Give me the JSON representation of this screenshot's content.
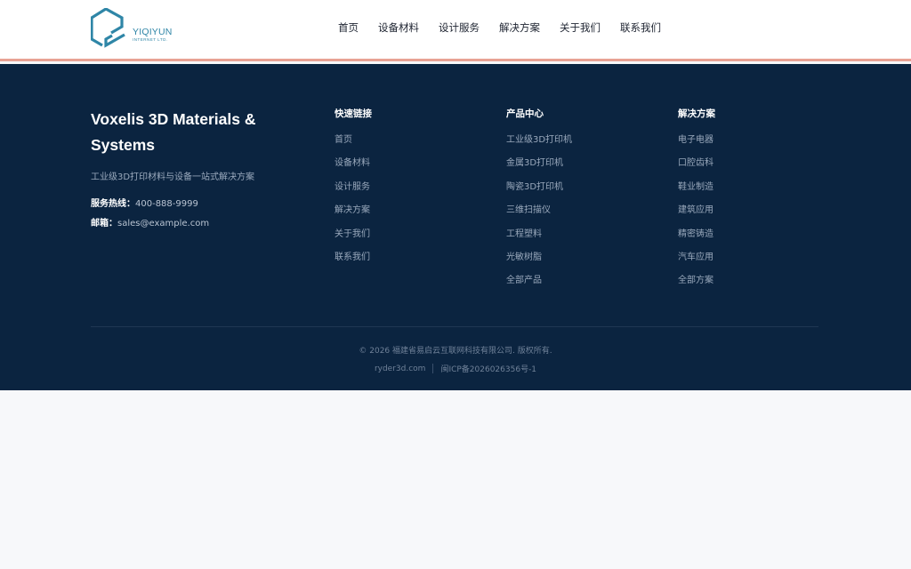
{
  "header": {
    "logo": {
      "name": "YIQIYUN",
      "subtitle": "INTERNET LTD.",
      "color": "#2f86a7"
    },
    "nav": [
      {
        "label": "首页"
      },
      {
        "label": "设备材料"
      },
      {
        "label": "设计服务"
      },
      {
        "label": "解决方案"
      },
      {
        "label": "关于我们"
      },
      {
        "label": "联系我们"
      }
    ]
  },
  "footer": {
    "brand": {
      "title": "Voxelis 3D Materials & Systems",
      "description": "工业级3D打印材料与设备一站式解决方案",
      "hotline_label": "服务热线：",
      "hotline_value": "400-888-9999",
      "email_label": "邮箱：",
      "email_value": "sales@example.com"
    },
    "columns": [
      {
        "title": "快速链接",
        "links": [
          "首页",
          "设备材料",
          "设计服务",
          "解决方案",
          "关于我们",
          "联系我们"
        ]
      },
      {
        "title": "产品中心",
        "links": [
          "工业级3D打印机",
          "金属3D打印机",
          "陶瓷3D打印机",
          "三维扫描仪",
          "工程塑料",
          "光敏树脂",
          "全部产品"
        ]
      },
      {
        "title": "解决方案",
        "links": [
          "电子电器",
          "口腔齿科",
          "鞋业制造",
          "建筑应用",
          "精密铸造",
          "汽车应用",
          "全部方案"
        ]
      }
    ],
    "copyright": "© 2026 福建省易启云互联网科技有限公司. 版权所有.",
    "domain": "ryder3d.com",
    "icp": "闽ICP备2026026356号-1",
    "background_color": "#0b2440",
    "accent_line_color": "#e8a294"
  }
}
